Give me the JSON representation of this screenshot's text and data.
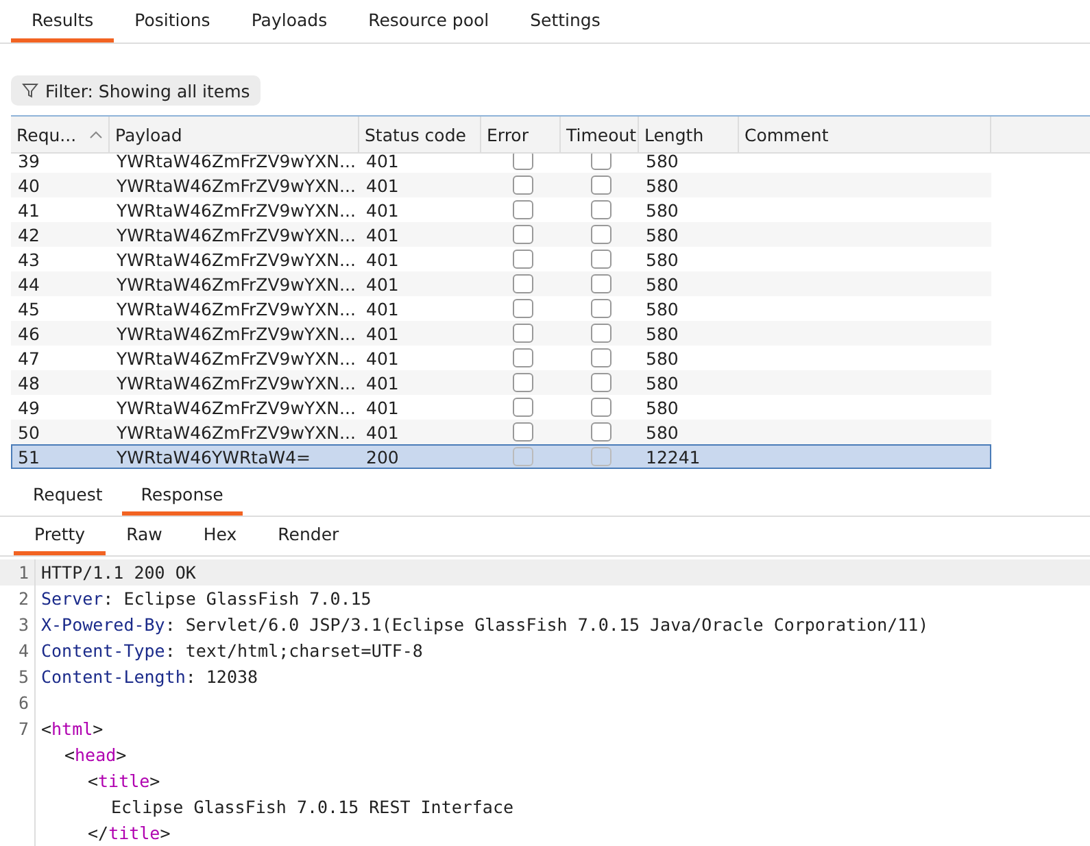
{
  "top_tabs": [
    {
      "label": "Results",
      "selected": true
    },
    {
      "label": "Positions",
      "selected": false
    },
    {
      "label": "Payloads",
      "selected": false
    },
    {
      "label": "Resource pool",
      "selected": false
    },
    {
      "label": "Settings",
      "selected": false
    }
  ],
  "filter": {
    "label": "Filter: Showing all items"
  },
  "table": {
    "columns": [
      {
        "label": "Requ...",
        "sorted_ascending": true
      },
      {
        "label": "Payload"
      },
      {
        "label": "Status code"
      },
      {
        "label": "Error"
      },
      {
        "label": "Timeout"
      },
      {
        "label": "Length"
      },
      {
        "label": "Comment"
      }
    ],
    "rows": [
      {
        "request": "39",
        "payload": "YWRtaW46ZmFrZV9wYXN...",
        "status": "401",
        "error": false,
        "timeout": false,
        "length": "580",
        "selected": false
      },
      {
        "request": "40",
        "payload": "YWRtaW46ZmFrZV9wYXN...",
        "status": "401",
        "error": false,
        "timeout": false,
        "length": "580",
        "selected": false
      },
      {
        "request": "41",
        "payload": "YWRtaW46ZmFrZV9wYXN...",
        "status": "401",
        "error": false,
        "timeout": false,
        "length": "580",
        "selected": false
      },
      {
        "request": "42",
        "payload": "YWRtaW46ZmFrZV9wYXN...",
        "status": "401",
        "error": false,
        "timeout": false,
        "length": "580",
        "selected": false
      },
      {
        "request": "43",
        "payload": "YWRtaW46ZmFrZV9wYXN...",
        "status": "401",
        "error": false,
        "timeout": false,
        "length": "580",
        "selected": false
      },
      {
        "request": "44",
        "payload": "YWRtaW46ZmFrZV9wYXN...",
        "status": "401",
        "error": false,
        "timeout": false,
        "length": "580",
        "selected": false
      },
      {
        "request": "45",
        "payload": "YWRtaW46ZmFrZV9wYXN...",
        "status": "401",
        "error": false,
        "timeout": false,
        "length": "580",
        "selected": false
      },
      {
        "request": "46",
        "payload": "YWRtaW46ZmFrZV9wYXN...",
        "status": "401",
        "error": false,
        "timeout": false,
        "length": "580",
        "selected": false
      },
      {
        "request": "47",
        "payload": "YWRtaW46ZmFrZV9wYXN...",
        "status": "401",
        "error": false,
        "timeout": false,
        "length": "580",
        "selected": false
      },
      {
        "request": "48",
        "payload": "YWRtaW46ZmFrZV9wYXN...",
        "status": "401",
        "error": false,
        "timeout": false,
        "length": "580",
        "selected": false
      },
      {
        "request": "49",
        "payload": "YWRtaW46ZmFrZV9wYXN...",
        "status": "401",
        "error": false,
        "timeout": false,
        "length": "580",
        "selected": false
      },
      {
        "request": "50",
        "payload": "YWRtaW46ZmFrZV9wYXN...",
        "status": "401",
        "error": false,
        "timeout": false,
        "length": "580",
        "selected": false
      },
      {
        "request": "51",
        "payload": "YWRtaW46YWRtaW4=",
        "status": "200",
        "error": false,
        "timeout": false,
        "length": "12241",
        "selected": true
      }
    ]
  },
  "message_tabs": [
    {
      "label": "Request",
      "selected": false
    },
    {
      "label": "Response",
      "selected": true
    }
  ],
  "view_tabs": [
    {
      "label": "Pretty",
      "selected": true
    },
    {
      "label": "Raw",
      "selected": false
    },
    {
      "label": "Hex",
      "selected": false
    },
    {
      "label": "Render",
      "selected": false
    }
  ],
  "code_lines": [
    {
      "number": "1",
      "segments": [
        {
          "kind": "text",
          "text": "HTTP/1.1 200 OK"
        }
      ]
    },
    {
      "number": "2",
      "segments": [
        {
          "kind": "key",
          "text": "Server"
        },
        {
          "kind": "text",
          "text": ": Eclipse GlassFish 7.0.15"
        }
      ]
    },
    {
      "number": "3",
      "segments": [
        {
          "kind": "key",
          "text": "X-Powered-By"
        },
        {
          "kind": "text",
          "text": ": Servlet/6.0 JSP/3.1(Eclipse GlassFish 7.0.15 Java/Oracle Corporation/11)"
        }
      ]
    },
    {
      "number": "4",
      "segments": [
        {
          "kind": "key",
          "text": "Content-Type"
        },
        {
          "kind": "text",
          "text": ": text/html;charset=UTF-8"
        }
      ]
    },
    {
      "number": "5",
      "segments": [
        {
          "kind": "key",
          "text": "Content-Length"
        },
        {
          "kind": "text",
          "text": ": 12038"
        }
      ]
    },
    {
      "number": "6"
    },
    {
      "number": "7",
      "segments": [
        {
          "kind": "text",
          "text": "<"
        },
        {
          "kind": "tag",
          "text": "html"
        },
        {
          "kind": "text",
          "text": ">"
        }
      ],
      "children": [
        {
          "segments": [
            {
              "kind": "text",
              "text": "<"
            },
            {
              "kind": "tag",
              "text": "head"
            },
            {
              "kind": "text",
              "text": ">"
            }
          ],
          "children": [
            {
              "segments": [
                {
                  "kind": "text",
                  "text": "<"
                },
                {
                  "kind": "tag",
                  "text": "title"
                },
                {
                  "kind": "text",
                  "text": ">"
                }
              ],
              "children": [
                {
                  "segments": [
                    {
                      "kind": "text",
                      "text": "Eclipse GlassFish 7.0.15 REST Interface"
                    }
                  ]
                }
              ]
            },
            {
              "segments": [
                {
                  "kind": "text",
                  "text": "</"
                },
                {
                  "kind": "tag",
                  "text": "title"
                },
                {
                  "kind": "text",
                  "text": ">"
                }
              ]
            }
          ]
        }
      ]
    }
  ]
}
